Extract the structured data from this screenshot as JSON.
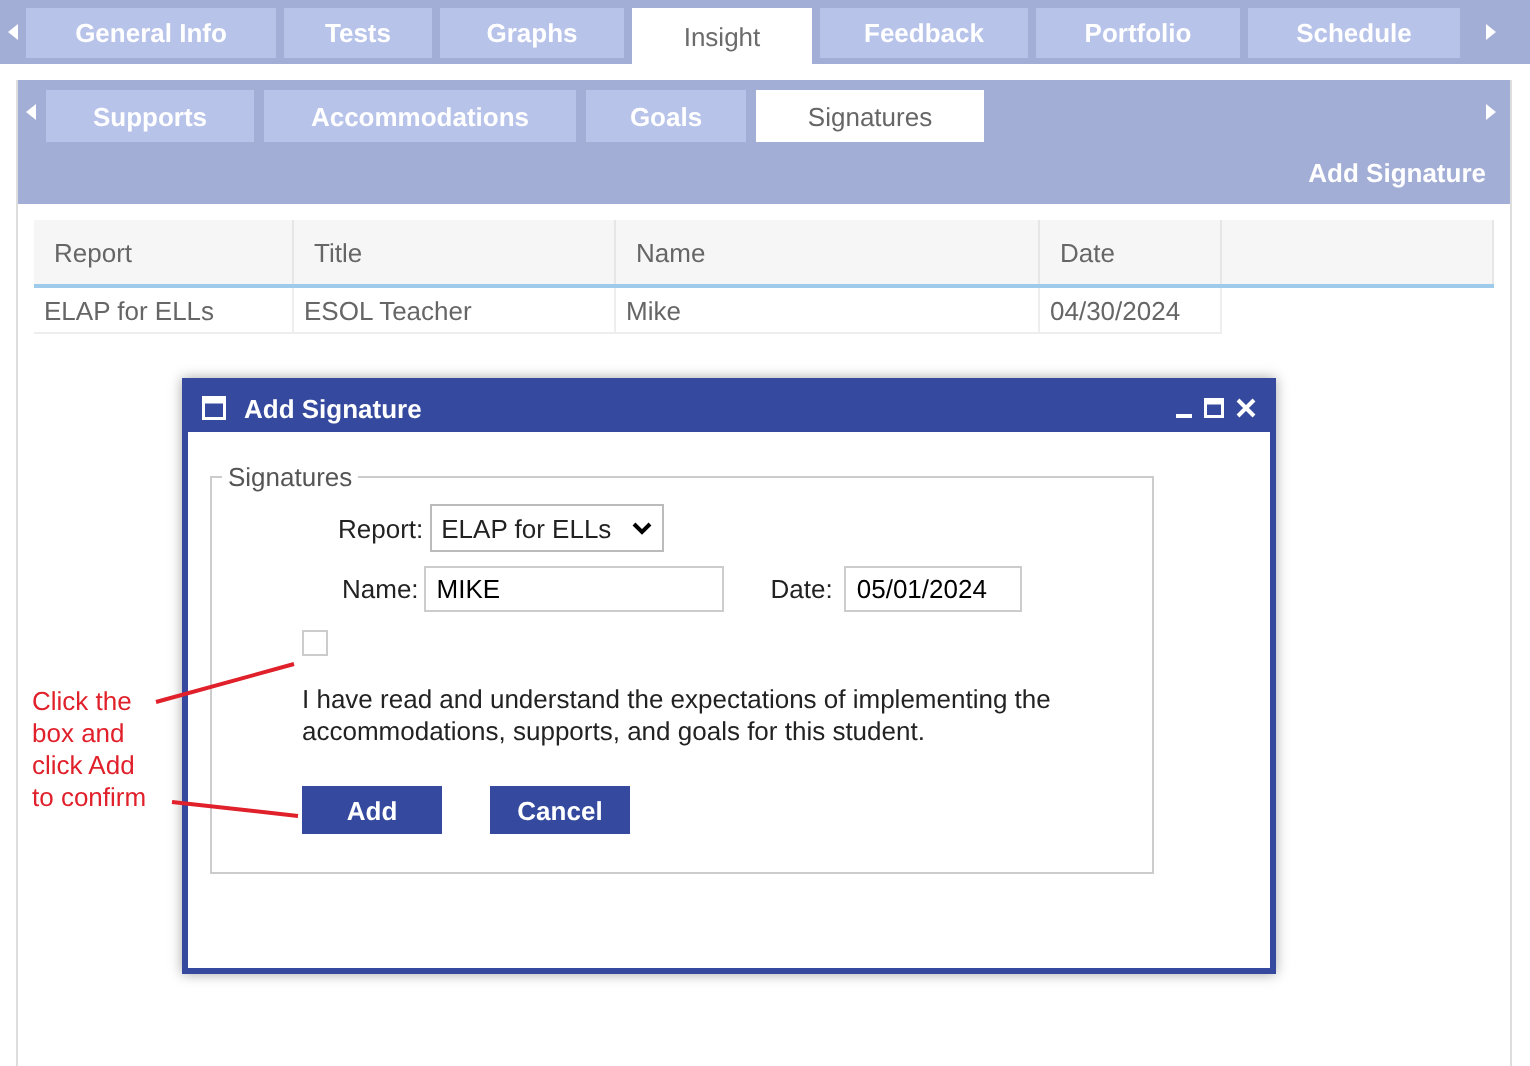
{
  "tabs": [
    {
      "label": "General Info",
      "selected": false
    },
    {
      "label": "Tests",
      "selected": false
    },
    {
      "label": "Graphs",
      "selected": false
    },
    {
      "label": "Insight",
      "selected": true
    },
    {
      "label": "Feedback",
      "selected": false
    },
    {
      "label": "Portfolio",
      "selected": false
    },
    {
      "label": "Schedule",
      "selected": false
    }
  ],
  "subtabs": [
    {
      "label": "Supports",
      "selected": false
    },
    {
      "label": "Accommodations",
      "selected": false
    },
    {
      "label": "Goals",
      "selected": false
    },
    {
      "label": "Signatures",
      "selected": true
    }
  ],
  "action": "Add Signature",
  "table": {
    "columns": [
      "Report",
      "Title",
      "Name",
      "Date"
    ],
    "rows": [
      [
        "ELAP for ELLs",
        "ESOL Teacher",
        "Mike",
        "04/30/2024"
      ]
    ]
  },
  "dialog": {
    "title": "Add Signature",
    "group": "Signatures",
    "report_label": "Report:",
    "report_value": "ELAP for ELLs",
    "name_label": "Name:",
    "name_value": "MIKE",
    "date_label": "Date:",
    "date_value": "05/01/2024",
    "agree_checked": false,
    "statement": "I have read and understand the expectations of implementing the accommodations, supports, and goals for this student.",
    "buttons": [
      "Add",
      "Cancel"
    ]
  },
  "annotation": "Click the box and click Add to confirm"
}
